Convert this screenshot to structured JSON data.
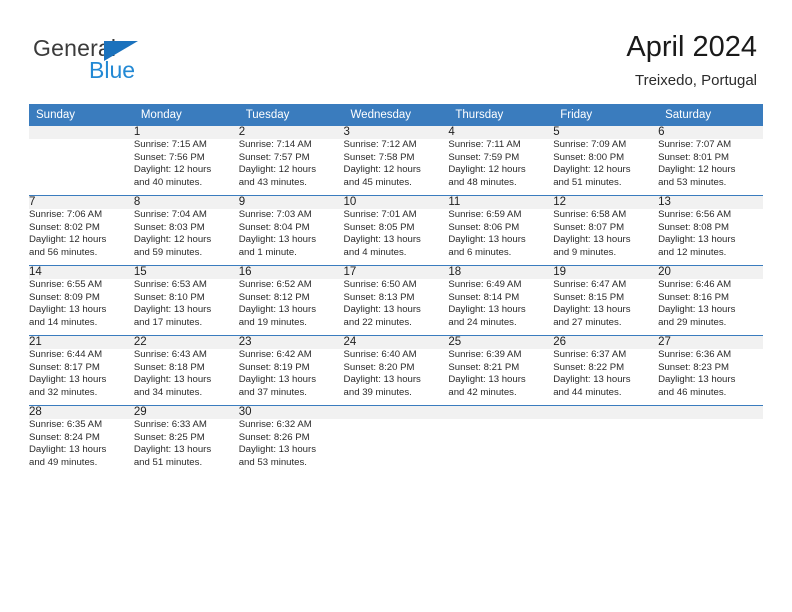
{
  "brand": {
    "name_primary": "General",
    "name_secondary": "Blue",
    "logo_icon": "blue-triangle-icon"
  },
  "header": {
    "title": "April 2024",
    "subtitle": "Treixedo, Portugal"
  },
  "colors": {
    "header_blue": "#3a7cbe",
    "brand_blue": "#2389d4",
    "logo_blue": "#1b72bd",
    "daynum_bg": "#f1f1f1",
    "text": "#2a2a2a"
  },
  "weekdays": [
    "Sunday",
    "Monday",
    "Tuesday",
    "Wednesday",
    "Thursday",
    "Friday",
    "Saturday"
  ],
  "weeks": [
    [
      {
        "day": "",
        "sunrise": "",
        "sunset": "",
        "daylight1": "",
        "daylight2": ""
      },
      {
        "day": "1",
        "sunrise": "Sunrise: 7:15 AM",
        "sunset": "Sunset: 7:56 PM",
        "daylight1": "Daylight: 12 hours",
        "daylight2": "and 40 minutes."
      },
      {
        "day": "2",
        "sunrise": "Sunrise: 7:14 AM",
        "sunset": "Sunset: 7:57 PM",
        "daylight1": "Daylight: 12 hours",
        "daylight2": "and 43 minutes."
      },
      {
        "day": "3",
        "sunrise": "Sunrise: 7:12 AM",
        "sunset": "Sunset: 7:58 PM",
        "daylight1": "Daylight: 12 hours",
        "daylight2": "and 45 minutes."
      },
      {
        "day": "4",
        "sunrise": "Sunrise: 7:11 AM",
        "sunset": "Sunset: 7:59 PM",
        "daylight1": "Daylight: 12 hours",
        "daylight2": "and 48 minutes."
      },
      {
        "day": "5",
        "sunrise": "Sunrise: 7:09 AM",
        "sunset": "Sunset: 8:00 PM",
        "daylight1": "Daylight: 12 hours",
        "daylight2": "and 51 minutes."
      },
      {
        "day": "6",
        "sunrise": "Sunrise: 7:07 AM",
        "sunset": "Sunset: 8:01 PM",
        "daylight1": "Daylight: 12 hours",
        "daylight2": "and 53 minutes."
      }
    ],
    [
      {
        "day": "7",
        "sunrise": "Sunrise: 7:06 AM",
        "sunset": "Sunset: 8:02 PM",
        "daylight1": "Daylight: 12 hours",
        "daylight2": "and 56 minutes."
      },
      {
        "day": "8",
        "sunrise": "Sunrise: 7:04 AM",
        "sunset": "Sunset: 8:03 PM",
        "daylight1": "Daylight: 12 hours",
        "daylight2": "and 59 minutes."
      },
      {
        "day": "9",
        "sunrise": "Sunrise: 7:03 AM",
        "sunset": "Sunset: 8:04 PM",
        "daylight1": "Daylight: 13 hours",
        "daylight2": "and 1 minute."
      },
      {
        "day": "10",
        "sunrise": "Sunrise: 7:01 AM",
        "sunset": "Sunset: 8:05 PM",
        "daylight1": "Daylight: 13 hours",
        "daylight2": "and 4 minutes."
      },
      {
        "day": "11",
        "sunrise": "Sunrise: 6:59 AM",
        "sunset": "Sunset: 8:06 PM",
        "daylight1": "Daylight: 13 hours",
        "daylight2": "and 6 minutes."
      },
      {
        "day": "12",
        "sunrise": "Sunrise: 6:58 AM",
        "sunset": "Sunset: 8:07 PM",
        "daylight1": "Daylight: 13 hours",
        "daylight2": "and 9 minutes."
      },
      {
        "day": "13",
        "sunrise": "Sunrise: 6:56 AM",
        "sunset": "Sunset: 8:08 PM",
        "daylight1": "Daylight: 13 hours",
        "daylight2": "and 12 minutes."
      }
    ],
    [
      {
        "day": "14",
        "sunrise": "Sunrise: 6:55 AM",
        "sunset": "Sunset: 8:09 PM",
        "daylight1": "Daylight: 13 hours",
        "daylight2": "and 14 minutes."
      },
      {
        "day": "15",
        "sunrise": "Sunrise: 6:53 AM",
        "sunset": "Sunset: 8:10 PM",
        "daylight1": "Daylight: 13 hours",
        "daylight2": "and 17 minutes."
      },
      {
        "day": "16",
        "sunrise": "Sunrise: 6:52 AM",
        "sunset": "Sunset: 8:12 PM",
        "daylight1": "Daylight: 13 hours",
        "daylight2": "and 19 minutes."
      },
      {
        "day": "17",
        "sunrise": "Sunrise: 6:50 AM",
        "sunset": "Sunset: 8:13 PM",
        "daylight1": "Daylight: 13 hours",
        "daylight2": "and 22 minutes."
      },
      {
        "day": "18",
        "sunrise": "Sunrise: 6:49 AM",
        "sunset": "Sunset: 8:14 PM",
        "daylight1": "Daylight: 13 hours",
        "daylight2": "and 24 minutes."
      },
      {
        "day": "19",
        "sunrise": "Sunrise: 6:47 AM",
        "sunset": "Sunset: 8:15 PM",
        "daylight1": "Daylight: 13 hours",
        "daylight2": "and 27 minutes."
      },
      {
        "day": "20",
        "sunrise": "Sunrise: 6:46 AM",
        "sunset": "Sunset: 8:16 PM",
        "daylight1": "Daylight: 13 hours",
        "daylight2": "and 29 minutes."
      }
    ],
    [
      {
        "day": "21",
        "sunrise": "Sunrise: 6:44 AM",
        "sunset": "Sunset: 8:17 PM",
        "daylight1": "Daylight: 13 hours",
        "daylight2": "and 32 minutes."
      },
      {
        "day": "22",
        "sunrise": "Sunrise: 6:43 AM",
        "sunset": "Sunset: 8:18 PM",
        "daylight1": "Daylight: 13 hours",
        "daylight2": "and 34 minutes."
      },
      {
        "day": "23",
        "sunrise": "Sunrise: 6:42 AM",
        "sunset": "Sunset: 8:19 PM",
        "daylight1": "Daylight: 13 hours",
        "daylight2": "and 37 minutes."
      },
      {
        "day": "24",
        "sunrise": "Sunrise: 6:40 AM",
        "sunset": "Sunset: 8:20 PM",
        "daylight1": "Daylight: 13 hours",
        "daylight2": "and 39 minutes."
      },
      {
        "day": "25",
        "sunrise": "Sunrise: 6:39 AM",
        "sunset": "Sunset: 8:21 PM",
        "daylight1": "Daylight: 13 hours",
        "daylight2": "and 42 minutes."
      },
      {
        "day": "26",
        "sunrise": "Sunrise: 6:37 AM",
        "sunset": "Sunset: 8:22 PM",
        "daylight1": "Daylight: 13 hours",
        "daylight2": "and 44 minutes."
      },
      {
        "day": "27",
        "sunrise": "Sunrise: 6:36 AM",
        "sunset": "Sunset: 8:23 PM",
        "daylight1": "Daylight: 13 hours",
        "daylight2": "and 46 minutes."
      }
    ],
    [
      {
        "day": "28",
        "sunrise": "Sunrise: 6:35 AM",
        "sunset": "Sunset: 8:24 PM",
        "daylight1": "Daylight: 13 hours",
        "daylight2": "and 49 minutes."
      },
      {
        "day": "29",
        "sunrise": "Sunrise: 6:33 AM",
        "sunset": "Sunset: 8:25 PM",
        "daylight1": "Daylight: 13 hours",
        "daylight2": "and 51 minutes."
      },
      {
        "day": "30",
        "sunrise": "Sunrise: 6:32 AM",
        "sunset": "Sunset: 8:26 PM",
        "daylight1": "Daylight: 13 hours",
        "daylight2": "and 53 minutes."
      },
      {
        "day": "",
        "sunrise": "",
        "sunset": "",
        "daylight1": "",
        "daylight2": ""
      },
      {
        "day": "",
        "sunrise": "",
        "sunset": "",
        "daylight1": "",
        "daylight2": ""
      },
      {
        "day": "",
        "sunrise": "",
        "sunset": "",
        "daylight1": "",
        "daylight2": ""
      },
      {
        "day": "",
        "sunrise": "",
        "sunset": "",
        "daylight1": "",
        "daylight2": ""
      }
    ]
  ]
}
